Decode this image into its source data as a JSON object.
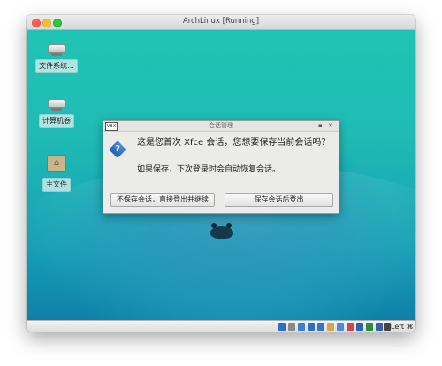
{
  "window": {
    "title": "ArchLinux [Running]"
  },
  "desktop": {
    "icons": [
      {
        "name": "File System",
        "label": "文件系统..."
      },
      {
        "name": "Drive",
        "label": "计算机卷"
      },
      {
        "name": "Home",
        "label": "主文件"
      }
    ]
  },
  "dialog": {
    "title": "会话管理",
    "message_primary": "这是您首次 Xfce 会话，您想要保存当前会话吗？",
    "message_secondary": "如果保存，下次登录时会自动恢复会话。",
    "button_left": "不保存会话，直接登出并继续",
    "button_right": "保存会话后登出",
    "min_glyph": "▪",
    "close_glyph": "✕",
    "logo_text": "VBX",
    "question_glyph": "?"
  },
  "statusbar": {
    "host_key": "Left ⌘",
    "icons": [
      {
        "name": "hard-disk-icon",
        "color": "#2d6fc4"
      },
      {
        "name": "optical-drive-icon",
        "color": "#8a8a8a"
      },
      {
        "name": "audio-icon",
        "color": "#3b7fd0"
      },
      {
        "name": "network-icon",
        "color": "#2f6ec0"
      },
      {
        "name": "usb-icon",
        "color": "#3576c8"
      },
      {
        "name": "shared-folder-icon",
        "color": "#d2a64a"
      },
      {
        "name": "display-icon",
        "color": "#4b8ad6"
      },
      {
        "name": "recording-icon",
        "color": "#c64a4a"
      },
      {
        "name": "cpu-icon",
        "color": "#2b62b4"
      },
      {
        "name": "virtualization-icon",
        "color": "#2c8a3c"
      },
      {
        "name": "mouse-integration-icon",
        "color": "#355fa8"
      },
      {
        "name": "host-key-arrow-icon",
        "color": "#444444"
      }
    ]
  }
}
